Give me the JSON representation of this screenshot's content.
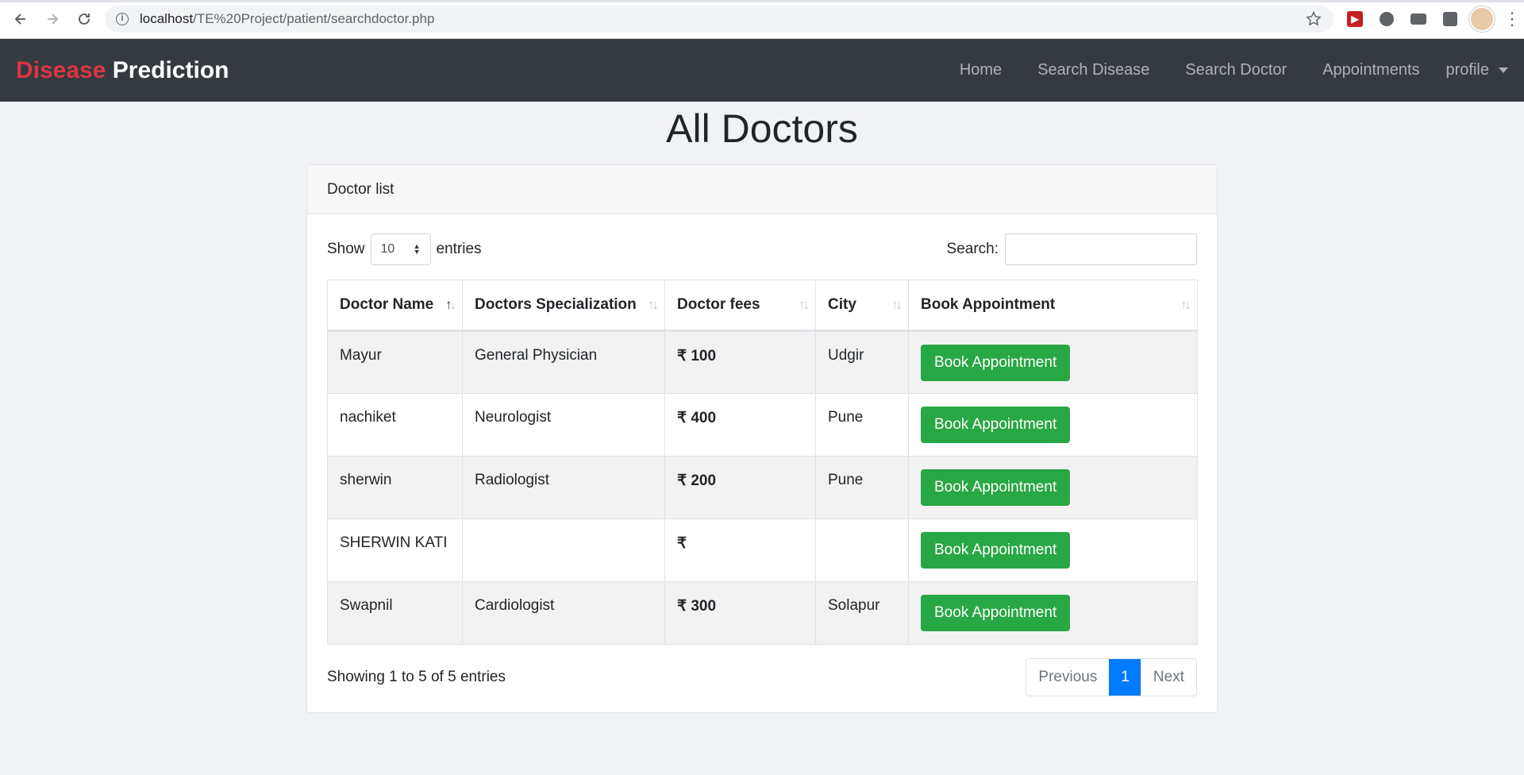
{
  "browser": {
    "url_host": "localhost",
    "url_path": "/TE%20Project/patient/searchdoctor.php"
  },
  "navbar": {
    "brand_part1": "Disease",
    "brand_part2": "Prediction",
    "links": [
      "Home",
      "Search Disease",
      "Search Doctor",
      "Appointments"
    ],
    "profile_label": "profile"
  },
  "page": {
    "title": "All Doctors",
    "card_title": "Doctor list"
  },
  "controls": {
    "show_label": "Show",
    "entries_value": "10",
    "entries_label": "entries",
    "search_label": "Search:",
    "search_value": ""
  },
  "table": {
    "headers": [
      "Doctor Name",
      "Doctors Specialization",
      "Doctor fees",
      "City",
      "Book Appointment"
    ],
    "currency_symbol": "₹",
    "rows": [
      {
        "name": "Mayur",
        "specialization": "General Physician",
        "fee": "₹ 100",
        "city": "Udgir",
        "action": "Book Appointment"
      },
      {
        "name": "nachiket",
        "specialization": "Neurologist",
        "fee": "₹ 400",
        "city": "Pune",
        "action": "Book Appointment"
      },
      {
        "name": "sherwin",
        "specialization": "Radiologist",
        "fee": "₹ 200",
        "city": "Pune",
        "action": "Book Appointment"
      },
      {
        "name": "SHERWIN KATI",
        "specialization": "",
        "fee": "₹",
        "city": "",
        "action": "Book Appointment"
      },
      {
        "name": "Swapnil",
        "specialization": "Cardiologist",
        "fee": "₹ 300",
        "city": "Solapur",
        "action": "Book Appointment"
      }
    ]
  },
  "footer": {
    "info": "Showing 1 to 5 of 5 entries",
    "previous": "Previous",
    "current_page": "1",
    "next": "Next"
  },
  "colors": {
    "navbar_bg": "#343a40",
    "brand_accent": "#dc3545",
    "book_button": "#28a745",
    "page_active": "#007bff"
  }
}
